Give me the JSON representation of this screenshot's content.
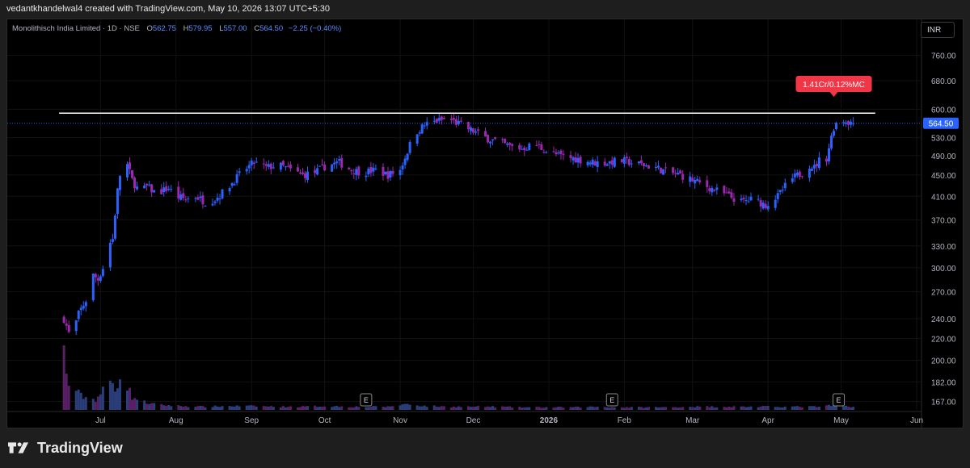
{
  "caption": "vedantkhandelwal4 created with TradingView.com, May 10, 2026 13:07 UTC+5:30",
  "legend": {
    "title": "Monolithisch India Limited · 1D · NSE",
    "o_label": "O",
    "o_value": "562.75",
    "h_label": "H",
    "h_value": "579.95",
    "l_label": "L",
    "l_value": "557.00",
    "c_label": "C",
    "c_value": "564.50",
    "change": "−2.25 (−0.40%)"
  },
  "currency": "INR",
  "footer_brand": "TradingView",
  "colors": {
    "up": "#2962ff",
    "down": "#9c27b0",
    "hline": "#ffffff",
    "price_tag": "#2962ff",
    "callout": "#f23645",
    "vol_up": "#2a3e7a",
    "vol_down": "#5a1f66"
  },
  "chart_data": {
    "type": "candlestick",
    "symbol": "Monolithisch India Limited",
    "timeframe": "1D",
    "exchange": "NSE",
    "y_scale": "log",
    "ylim": [
      161,
      800
    ],
    "y_ticks": [
      "760.00",
      "680.00",
      "600.00",
      "530.00",
      "490.00",
      "450.00",
      "410.00",
      "370.00",
      "330.00",
      "300.00",
      "270.00",
      "240.00",
      "220.00",
      "200.00",
      "182.00",
      "167.00"
    ],
    "x_ticks": [
      "Jul",
      "Aug",
      "Sep",
      "Oct",
      "Nov",
      "Dec",
      "2026",
      "Feb",
      "Mar",
      "Apr",
      "May",
      "Jun"
    ],
    "x_tick_days": [
      17,
      48,
      79,
      109,
      140,
      170,
      201,
      232,
      260,
      291,
      321,
      352
    ],
    "last_price": "564.50",
    "horizontal_line": {
      "price": 590,
      "from_day": 0,
      "to_day": 335
    },
    "callout": {
      "text": "1.41Cr/0.12%MC",
      "day": 318
    },
    "earnings_markers": [
      {
        "label": "E",
        "day": 126
      },
      {
        "label": "E",
        "day": 227
      },
      {
        "label": "E",
        "day": 320
      }
    ],
    "anchor_closes": [
      [
        2,
        240
      ],
      [
        4,
        225
      ],
      [
        6,
        228
      ],
      [
        8,
        245
      ],
      [
        10,
        255
      ],
      [
        12,
        265
      ],
      [
        14,
        290
      ],
      [
        16,
        285
      ],
      [
        18,
        300
      ],
      [
        20,
        330
      ],
      [
        22,
        340
      ],
      [
        24,
        420
      ],
      [
        26,
        480
      ],
      [
        28,
        470
      ],
      [
        30,
        440
      ],
      [
        32,
        425
      ],
      [
        34,
        420
      ],
      [
        36,
        428
      ],
      [
        40,
        415
      ],
      [
        45,
        425
      ],
      [
        48,
        410
      ],
      [
        52,
        405
      ],
      [
        56,
        410
      ],
      [
        60,
        400
      ],
      [
        64,
        405
      ],
      [
        68,
        420
      ],
      [
        72,
        440
      ],
      [
        76,
        460
      ],
      [
        80,
        475
      ],
      [
        85,
        465
      ],
      [
        90,
        470
      ],
      [
        95,
        460
      ],
      [
        100,
        450
      ],
      [
        105,
        455
      ],
      [
        110,
        470
      ],
      [
        115,
        475
      ],
      [
        120,
        460
      ],
      [
        125,
        455
      ],
      [
        130,
        460
      ],
      [
        135,
        450
      ],
      [
        140,
        460
      ],
      [
        143,
        500
      ],
      [
        146,
        540
      ],
      [
        150,
        560
      ],
      [
        155,
        570
      ],
      [
        160,
        575
      ],
      [
        165,
        560
      ],
      [
        170,
        545
      ],
      [
        175,
        530
      ],
      [
        180,
        520
      ],
      [
        185,
        510
      ],
      [
        190,
        505
      ],
      [
        195,
        515
      ],
      [
        200,
        500
      ],
      [
        205,
        490
      ],
      [
        210,
        485
      ],
      [
        215,
        480
      ],
      [
        220,
        475
      ],
      [
        225,
        475
      ],
      [
        230,
        480
      ],
      [
        235,
        475
      ],
      [
        240,
        470
      ],
      [
        245,
        465
      ],
      [
        250,
        455
      ],
      [
        255,
        450
      ],
      [
        260,
        440
      ],
      [
        265,
        430
      ],
      [
        270,
        420
      ],
      [
        275,
        410
      ],
      [
        280,
        400
      ],
      [
        285,
        405
      ],
      [
        290,
        395
      ],
      [
        295,
        410
      ],
      [
        300,
        440
      ],
      [
        305,
        455
      ],
      [
        308,
        470
      ],
      [
        310,
        465
      ],
      [
        312,
        480
      ],
      [
        315,
        485
      ],
      [
        318,
        555
      ],
      [
        320,
        575
      ],
      [
        323,
        570
      ],
      [
        326,
        564.5
      ]
    ],
    "volume_relative": [
      [
        2,
        0.92
      ],
      [
        3,
        0.55
      ],
      [
        5,
        0.25
      ],
      [
        7,
        0.3
      ],
      [
        9,
        0.22
      ],
      [
        12,
        0.18
      ],
      [
        15,
        0.16
      ],
      [
        17,
        0.25
      ],
      [
        19,
        0.35
      ],
      [
        21,
        0.45
      ],
      [
        23,
        0.3
      ],
      [
        25,
        0.55
      ],
      [
        27,
        0.45
      ],
      [
        30,
        0.2
      ],
      [
        35,
        0.12
      ],
      [
        40,
        0.08
      ],
      [
        50,
        0.06
      ],
      [
        60,
        0.05
      ],
      [
        70,
        0.06
      ],
      [
        80,
        0.06
      ],
      [
        90,
        0.05
      ],
      [
        100,
        0.05
      ],
      [
        110,
        0.06
      ],
      [
        120,
        0.05
      ],
      [
        126,
        0.05
      ],
      [
        135,
        0.05
      ],
      [
        142,
        0.09
      ],
      [
        146,
        0.08
      ],
      [
        150,
        0.06
      ],
      [
        160,
        0.05
      ],
      [
        170,
        0.05
      ],
      [
        180,
        0.05
      ],
      [
        190,
        0.04
      ],
      [
        200,
        0.04
      ],
      [
        210,
        0.04
      ],
      [
        220,
        0.05
      ],
      [
        230,
        0.04
      ],
      [
        240,
        0.04
      ],
      [
        250,
        0.04
      ],
      [
        260,
        0.05
      ],
      [
        270,
        0.05
      ],
      [
        280,
        0.05
      ],
      [
        290,
        0.05
      ],
      [
        300,
        0.05
      ],
      [
        312,
        0.05
      ],
      [
        318,
        0.07
      ],
      [
        322,
        0.06
      ],
      [
        326,
        0.05
      ]
    ]
  }
}
